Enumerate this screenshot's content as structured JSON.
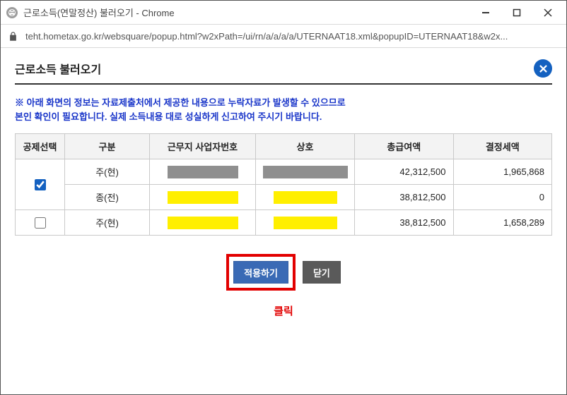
{
  "window": {
    "title": "근로소득(연말정산) 불러오기 - Chrome",
    "url": "teht.hometax.go.kr/websquare/popup.html?w2xPath=/ui/rn/a/a/a/a/UTERNAAT18.xml&popupID=UTERNAAT18&w2x..."
  },
  "page": {
    "title": "근로소득 불러오기",
    "notice_line1": "※ 아래 화면의 정보는 자료제출처에서 제공한 내용으로 누락자료가 발생할 수 있으므로",
    "notice_line2": "본인 확인이 필요합니다. 실제 소득내용 대로 성실하게 신고하여 주시기 바랍니다.",
    "click_label": "클릭"
  },
  "table": {
    "headers": {
      "select": "공제선택",
      "type": "구분",
      "biz_no": "근무지 사업자번호",
      "name": "상호",
      "pay": "총급여액",
      "tax": "결정세액"
    },
    "rows": [
      {
        "checked": true,
        "type": "주(현)",
        "mask": "gray",
        "pay": "42,312,500",
        "tax": "1,965,868"
      },
      {
        "checked": true,
        "type": "종(전)",
        "mask": "yellow",
        "pay": "38,812,500",
        "tax": "0",
        "merge_with_prev": true
      },
      {
        "checked": false,
        "type": "주(현)",
        "mask": "yellow",
        "pay": "38,812,500",
        "tax": "1,658,289"
      }
    ]
  },
  "buttons": {
    "apply": "적용하기",
    "close": "닫기"
  }
}
